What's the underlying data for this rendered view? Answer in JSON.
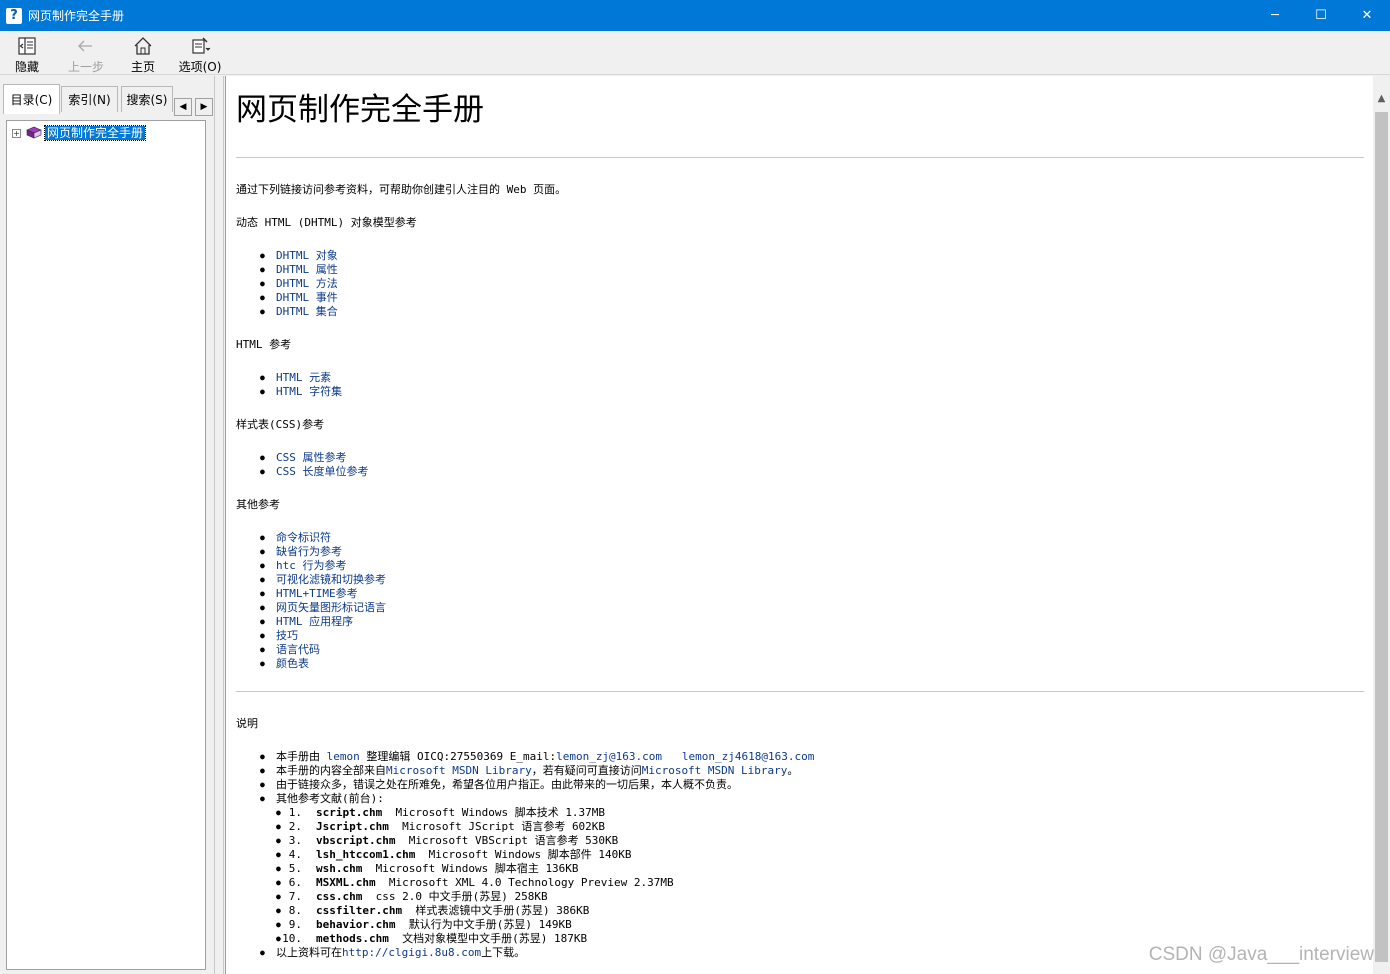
{
  "window": {
    "title": "网页制作完全手册",
    "app_icon": "help-book-icon",
    "minimize": "─",
    "maximize": "☐",
    "close": "✕"
  },
  "toolbar": {
    "hide": "隐藏",
    "back": "上一步",
    "home": "主页",
    "options": "选项(O)"
  },
  "nav": {
    "tabs": [
      {
        "label": "目录(C)"
      },
      {
        "label": "索引(N)"
      },
      {
        "label": "搜索(S)"
      }
    ],
    "tree": [
      {
        "label": "网页制作完全手册",
        "expander": "+"
      }
    ]
  },
  "content": {
    "heading": "网页制作完全手册",
    "intro": "通过下列链接访问参考资料，可帮助你创建引人注目的 Web 页面。",
    "sections": [
      {
        "title": "动态 HTML (DHTML) 对象模型参考",
        "links": [
          "DHTML 对象",
          "DHTML 属性",
          "DHTML 方法",
          "DHTML 事件",
          "DHTML 集合"
        ]
      },
      {
        "title": "HTML 参考",
        "links": [
          "HTML 元素",
          "HTML 字符集"
        ]
      },
      {
        "title": "样式表(CSS)参考",
        "links": [
          "CSS 属性参考",
          "CSS 长度单位参考"
        ]
      },
      {
        "title": "其他参考",
        "links": [
          "命令标识符",
          "缺省行为参考",
          "htc 行为参考",
          "可视化滤镜和切换参考",
          "HTML+TIME参考",
          "网页矢量图形标记语言",
          "HTML 应用程序",
          "技巧",
          "语言代码",
          "颜色表"
        ]
      }
    ],
    "notes": {
      "title": "说明",
      "line1": {
        "pre": "本手册由 ",
        "author": "lemon",
        "mid": " 整理编辑 OICQ:27550369 E_mail:",
        "email1": "lemon_zj@163.com",
        "email2": "lemon_zj4618@163.com"
      },
      "line2": {
        "pre": "本手册的内容全部来自",
        "link1": "Microsoft MSDN Library",
        "mid": "，若有疑问可直接访问",
        "link2": "Microsoft MSDN Library",
        "post": "。"
      },
      "line3": "由于链接众多，错误之处在所难免，希望各位用户指正。由此带来的一切后果，本人概不负责。",
      "line4": "其他参考文献(前台):",
      "refs": [
        {
          "num": "1.",
          "file": "script.chm",
          "desc": "Microsoft Windows 脚本技术 1.37MB"
        },
        {
          "num": "2.",
          "file": "Jscript.chm",
          "desc": "Microsoft JScript 语言参考 602KB"
        },
        {
          "num": "3.",
          "file": "vbscript.chm",
          "desc": "Microsoft VBScript 语言参考 530KB"
        },
        {
          "num": "4.",
          "file": "lsh_htccom1.chm",
          "desc": "Microsoft Windows 脚本部件 140KB"
        },
        {
          "num": "5.",
          "file": "wsh.chm",
          "desc": "Microsoft Windows 脚本宿主 136KB"
        },
        {
          "num": "6.",
          "file": "MSXML.chm",
          "desc": "Microsoft XML 4.0 Technology Preview 2.37MB"
        },
        {
          "num": "7.",
          "file": "css.chm",
          "desc": "css 2.0 中文手册(苏昱) 258KB"
        },
        {
          "num": "8.",
          "file": "cssfilter.chm",
          "desc": "样式表滤镜中文手册(苏昱) 386KB"
        },
        {
          "num": "9.",
          "file": "behavior.chm",
          "desc": "默认行为中文手册(苏昱) 149KB"
        },
        {
          "num": "10.",
          "file": "methods.chm",
          "desc": "文档对象模型中文手册(苏昱) 187KB"
        }
      ],
      "line5": {
        "pre": "以上资料可在",
        "link": "http://clgigi.8u8.com",
        "post": "上下载。"
      }
    }
  },
  "watermark": "CSDN @Java___interview",
  "colors": {
    "titlebar": "#0078d7",
    "link": "#0d3a8a",
    "selection": "#0078d7"
  }
}
